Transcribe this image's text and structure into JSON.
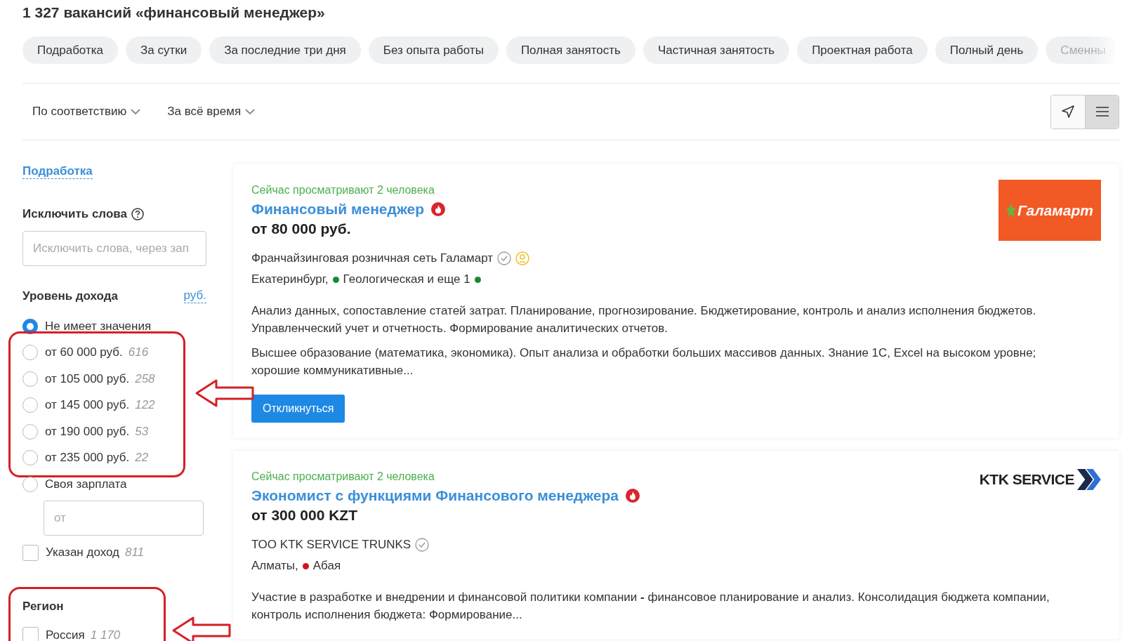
{
  "heading": "1 327 вакансий «финансовый менеджер»",
  "chips": [
    {
      "label": "Подработка",
      "faded": false
    },
    {
      "label": "За сутки",
      "faded": false
    },
    {
      "label": "За последние три дня",
      "faded": false
    },
    {
      "label": "Без опыта работы",
      "faded": false
    },
    {
      "label": "Полная занятость",
      "faded": false
    },
    {
      "label": "Частичная занятость",
      "faded": false
    },
    {
      "label": "Проектная работа",
      "faded": false
    },
    {
      "label": "Полный день",
      "faded": false
    },
    {
      "label": "Сменны",
      "faded": true
    }
  ],
  "sort": [
    {
      "label": "По соответствию"
    },
    {
      "label": "За всё время"
    }
  ],
  "view_toggle": [
    {
      "kind": "map",
      "selected": false
    },
    {
      "kind": "list",
      "selected": true
    }
  ],
  "sidebar": {
    "link": "Подработка",
    "exclude": {
      "label": "Исключить слова",
      "placeholder": "Исключить слова, через зап"
    },
    "income": {
      "label": "Уровень дохода",
      "currency": "руб.",
      "options": [
        {
          "label": "Не имеет значения",
          "selected": true
        },
        {
          "label": "от 60 000 руб.",
          "count": "616",
          "selected": false,
          "highlighted": true
        },
        {
          "label": "от 105 000 руб.",
          "count": "258",
          "selected": false,
          "highlighted": true
        },
        {
          "label": "от 145 000 руб.",
          "count": "122",
          "selected": false,
          "highlighted": true
        },
        {
          "label": "от 190 000 руб.",
          "count": "53",
          "selected": false,
          "highlighted": true
        },
        {
          "label": "от 235 000 руб.",
          "count": "22",
          "selected": false,
          "highlighted": true
        },
        {
          "label": "Своя зарплата",
          "selected": false
        }
      ],
      "custom_placeholder": "от",
      "specified": {
        "label": "Указан доход",
        "count": "811",
        "checked": false
      }
    },
    "region": {
      "label": "Регион",
      "highlighted": true,
      "items": [
        {
          "label": "Россия",
          "count": "1 170",
          "checked": false
        }
      ]
    }
  },
  "vacancies": [
    {
      "viewers": "Сейчас просматривают 2 человека",
      "title": "Финансовый менеджер",
      "hot": true,
      "salary": "от 80 000 руб.",
      "company": "Франчайзинговая розничная сеть Галамарт",
      "verified": true,
      "award": true,
      "logo": {
        "kind": "galamart",
        "text": "Галамарт"
      },
      "city": "Екатеринбург,",
      "stations": [
        {
          "name": "Геологическая и еще 1",
          "color": "#1a8a2e"
        },
        {
          "color": "#1a8a2e"
        }
      ],
      "description": [
        "Анализ данных, сопоставление статей затрат. Планирование, прогнозирование. Бюджетирование, контроль и анализ исполнения бюджетов. Управленческий учет и отчетность. Формирование аналитических отчетов.",
        "Высшее образование (математика, экономика). Опыт анализа и обработки больших массивов данных. Знание 1С, Excel на высоком уровне; хорошие коммуникативные..."
      ],
      "button": "Откликнуться"
    },
    {
      "viewers": "Сейчас просматривают 2 человека",
      "title": "Экономист с функциями Финансового менеджера",
      "hot": true,
      "salary": "от 300 000 KZT",
      "company": "ТОО KTK SERVICE TRUNKS",
      "verified": true,
      "award": false,
      "logo": {
        "kind": "ktk",
        "text": "KTK SERVICE"
      },
      "city": "Алматы,",
      "stations": [
        {
          "name": "Абая",
          "color": "#d0161b"
        }
      ],
      "description": [
        "Участие в разработке и внедрении и финансовой политики компании **-** финансовое планирование и анализ. Консолидация бюджета компании, контроль исполнения бюджета: Формирование..."
      ]
    }
  ]
}
